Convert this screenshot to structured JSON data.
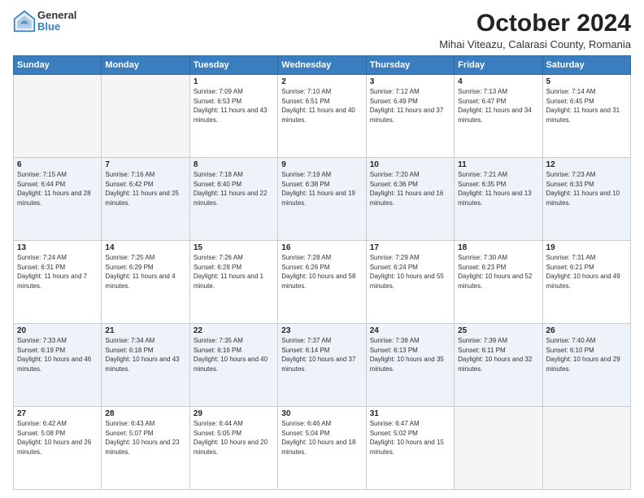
{
  "logo": {
    "general": "General",
    "blue": "Blue"
  },
  "header": {
    "month": "October 2024",
    "location": "Mihai Viteazu, Calarasi County, Romania"
  },
  "weekdays": [
    "Sunday",
    "Monday",
    "Tuesday",
    "Wednesday",
    "Thursday",
    "Friday",
    "Saturday"
  ],
  "weeks": [
    [
      {
        "day": "",
        "info": ""
      },
      {
        "day": "",
        "info": ""
      },
      {
        "day": "1",
        "info": "Sunrise: 7:09 AM\nSunset: 6:53 PM\nDaylight: 11 hours and 43 minutes."
      },
      {
        "day": "2",
        "info": "Sunrise: 7:10 AM\nSunset: 6:51 PM\nDaylight: 11 hours and 40 minutes."
      },
      {
        "day": "3",
        "info": "Sunrise: 7:12 AM\nSunset: 6:49 PM\nDaylight: 11 hours and 37 minutes."
      },
      {
        "day": "4",
        "info": "Sunrise: 7:13 AM\nSunset: 6:47 PM\nDaylight: 11 hours and 34 minutes."
      },
      {
        "day": "5",
        "info": "Sunrise: 7:14 AM\nSunset: 6:45 PM\nDaylight: 11 hours and 31 minutes."
      }
    ],
    [
      {
        "day": "6",
        "info": "Sunrise: 7:15 AM\nSunset: 6:44 PM\nDaylight: 11 hours and 28 minutes."
      },
      {
        "day": "7",
        "info": "Sunrise: 7:16 AM\nSunset: 6:42 PM\nDaylight: 11 hours and 25 minutes."
      },
      {
        "day": "8",
        "info": "Sunrise: 7:18 AM\nSunset: 6:40 PM\nDaylight: 11 hours and 22 minutes."
      },
      {
        "day": "9",
        "info": "Sunrise: 7:19 AM\nSunset: 6:38 PM\nDaylight: 11 hours and 19 minutes."
      },
      {
        "day": "10",
        "info": "Sunrise: 7:20 AM\nSunset: 6:36 PM\nDaylight: 11 hours and 16 minutes."
      },
      {
        "day": "11",
        "info": "Sunrise: 7:21 AM\nSunset: 6:35 PM\nDaylight: 11 hours and 13 minutes."
      },
      {
        "day": "12",
        "info": "Sunrise: 7:23 AM\nSunset: 6:33 PM\nDaylight: 11 hours and 10 minutes."
      }
    ],
    [
      {
        "day": "13",
        "info": "Sunrise: 7:24 AM\nSunset: 6:31 PM\nDaylight: 11 hours and 7 minutes."
      },
      {
        "day": "14",
        "info": "Sunrise: 7:25 AM\nSunset: 6:29 PM\nDaylight: 11 hours and 4 minutes."
      },
      {
        "day": "15",
        "info": "Sunrise: 7:26 AM\nSunset: 6:28 PM\nDaylight: 11 hours and 1 minute."
      },
      {
        "day": "16",
        "info": "Sunrise: 7:28 AM\nSunset: 6:26 PM\nDaylight: 10 hours and 58 minutes."
      },
      {
        "day": "17",
        "info": "Sunrise: 7:29 AM\nSunset: 6:24 PM\nDaylight: 10 hours and 55 minutes."
      },
      {
        "day": "18",
        "info": "Sunrise: 7:30 AM\nSunset: 6:23 PM\nDaylight: 10 hours and 52 minutes."
      },
      {
        "day": "19",
        "info": "Sunrise: 7:31 AM\nSunset: 6:21 PM\nDaylight: 10 hours and 49 minutes."
      }
    ],
    [
      {
        "day": "20",
        "info": "Sunrise: 7:33 AM\nSunset: 6:19 PM\nDaylight: 10 hours and 46 minutes."
      },
      {
        "day": "21",
        "info": "Sunrise: 7:34 AM\nSunset: 6:18 PM\nDaylight: 10 hours and 43 minutes."
      },
      {
        "day": "22",
        "info": "Sunrise: 7:35 AM\nSunset: 6:16 PM\nDaylight: 10 hours and 40 minutes."
      },
      {
        "day": "23",
        "info": "Sunrise: 7:37 AM\nSunset: 6:14 PM\nDaylight: 10 hours and 37 minutes."
      },
      {
        "day": "24",
        "info": "Sunrise: 7:38 AM\nSunset: 6:13 PM\nDaylight: 10 hours and 35 minutes."
      },
      {
        "day": "25",
        "info": "Sunrise: 7:39 AM\nSunset: 6:11 PM\nDaylight: 10 hours and 32 minutes."
      },
      {
        "day": "26",
        "info": "Sunrise: 7:40 AM\nSunset: 6:10 PM\nDaylight: 10 hours and 29 minutes."
      }
    ],
    [
      {
        "day": "27",
        "info": "Sunrise: 6:42 AM\nSunset: 5:08 PM\nDaylight: 10 hours and 26 minutes."
      },
      {
        "day": "28",
        "info": "Sunrise: 6:43 AM\nSunset: 5:07 PM\nDaylight: 10 hours and 23 minutes."
      },
      {
        "day": "29",
        "info": "Sunrise: 6:44 AM\nSunset: 5:05 PM\nDaylight: 10 hours and 20 minutes."
      },
      {
        "day": "30",
        "info": "Sunrise: 6:46 AM\nSunset: 5:04 PM\nDaylight: 10 hours and 18 minutes."
      },
      {
        "day": "31",
        "info": "Sunrise: 6:47 AM\nSunset: 5:02 PM\nDaylight: 10 hours and 15 minutes."
      },
      {
        "day": "",
        "info": ""
      },
      {
        "day": "",
        "info": ""
      }
    ]
  ]
}
